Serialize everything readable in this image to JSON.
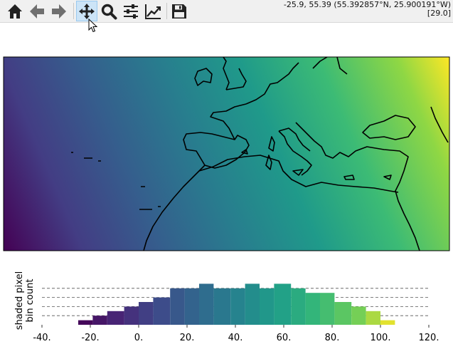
{
  "toolbar": {
    "buttons": [
      {
        "name": "home-button",
        "icon": "home-icon",
        "active": false
      },
      {
        "name": "back-button",
        "icon": "arrow-left-icon",
        "active": false
      },
      {
        "name": "forward-button",
        "icon": "arrow-right-icon",
        "active": false
      },
      {
        "name": "pan-button",
        "icon": "move-icon",
        "active": true
      },
      {
        "name": "zoom-button",
        "icon": "magnifier-icon",
        "active": false
      },
      {
        "name": "subplots-button",
        "icon": "sliders-icon",
        "active": false
      },
      {
        "name": "customize-button",
        "icon": "line-chart-icon",
        "active": false
      },
      {
        "name": "save-button",
        "icon": "floppy-disk-icon",
        "active": false
      }
    ],
    "coord_line1": "-25.9, 55.39 (55.392857°N, 25.900191°W)",
    "coord_line2": "[29.0]"
  },
  "colors": {
    "toolbar_bg": "#f0f0f0",
    "active_button": "#cce4f7",
    "icon": "#222222",
    "colormap": "viridis"
  },
  "chart_data": {
    "type": "bar",
    "ylabel": "shaded pixel\nbin count",
    "xlim": [
      -40,
      120
    ],
    "xticks": [
      "-40.",
      "-20.",
      "0.",
      "20.",
      "40.",
      "60.",
      "80.",
      "100.",
      "120."
    ],
    "bin_edges": [
      -25,
      -19,
      -13,
      -6,
      0,
      6,
      13,
      19,
      25,
      31,
      38,
      44,
      50,
      56,
      63,
      69,
      75,
      81,
      88,
      94,
      100,
      106
    ],
    "counts": [
      1,
      2,
      3,
      4,
      5,
      6,
      8,
      8,
      9,
      8,
      8,
      9,
      8,
      9,
      8,
      7,
      7,
      5,
      4,
      3,
      1
    ],
    "grid": "horizontal dashed"
  }
}
